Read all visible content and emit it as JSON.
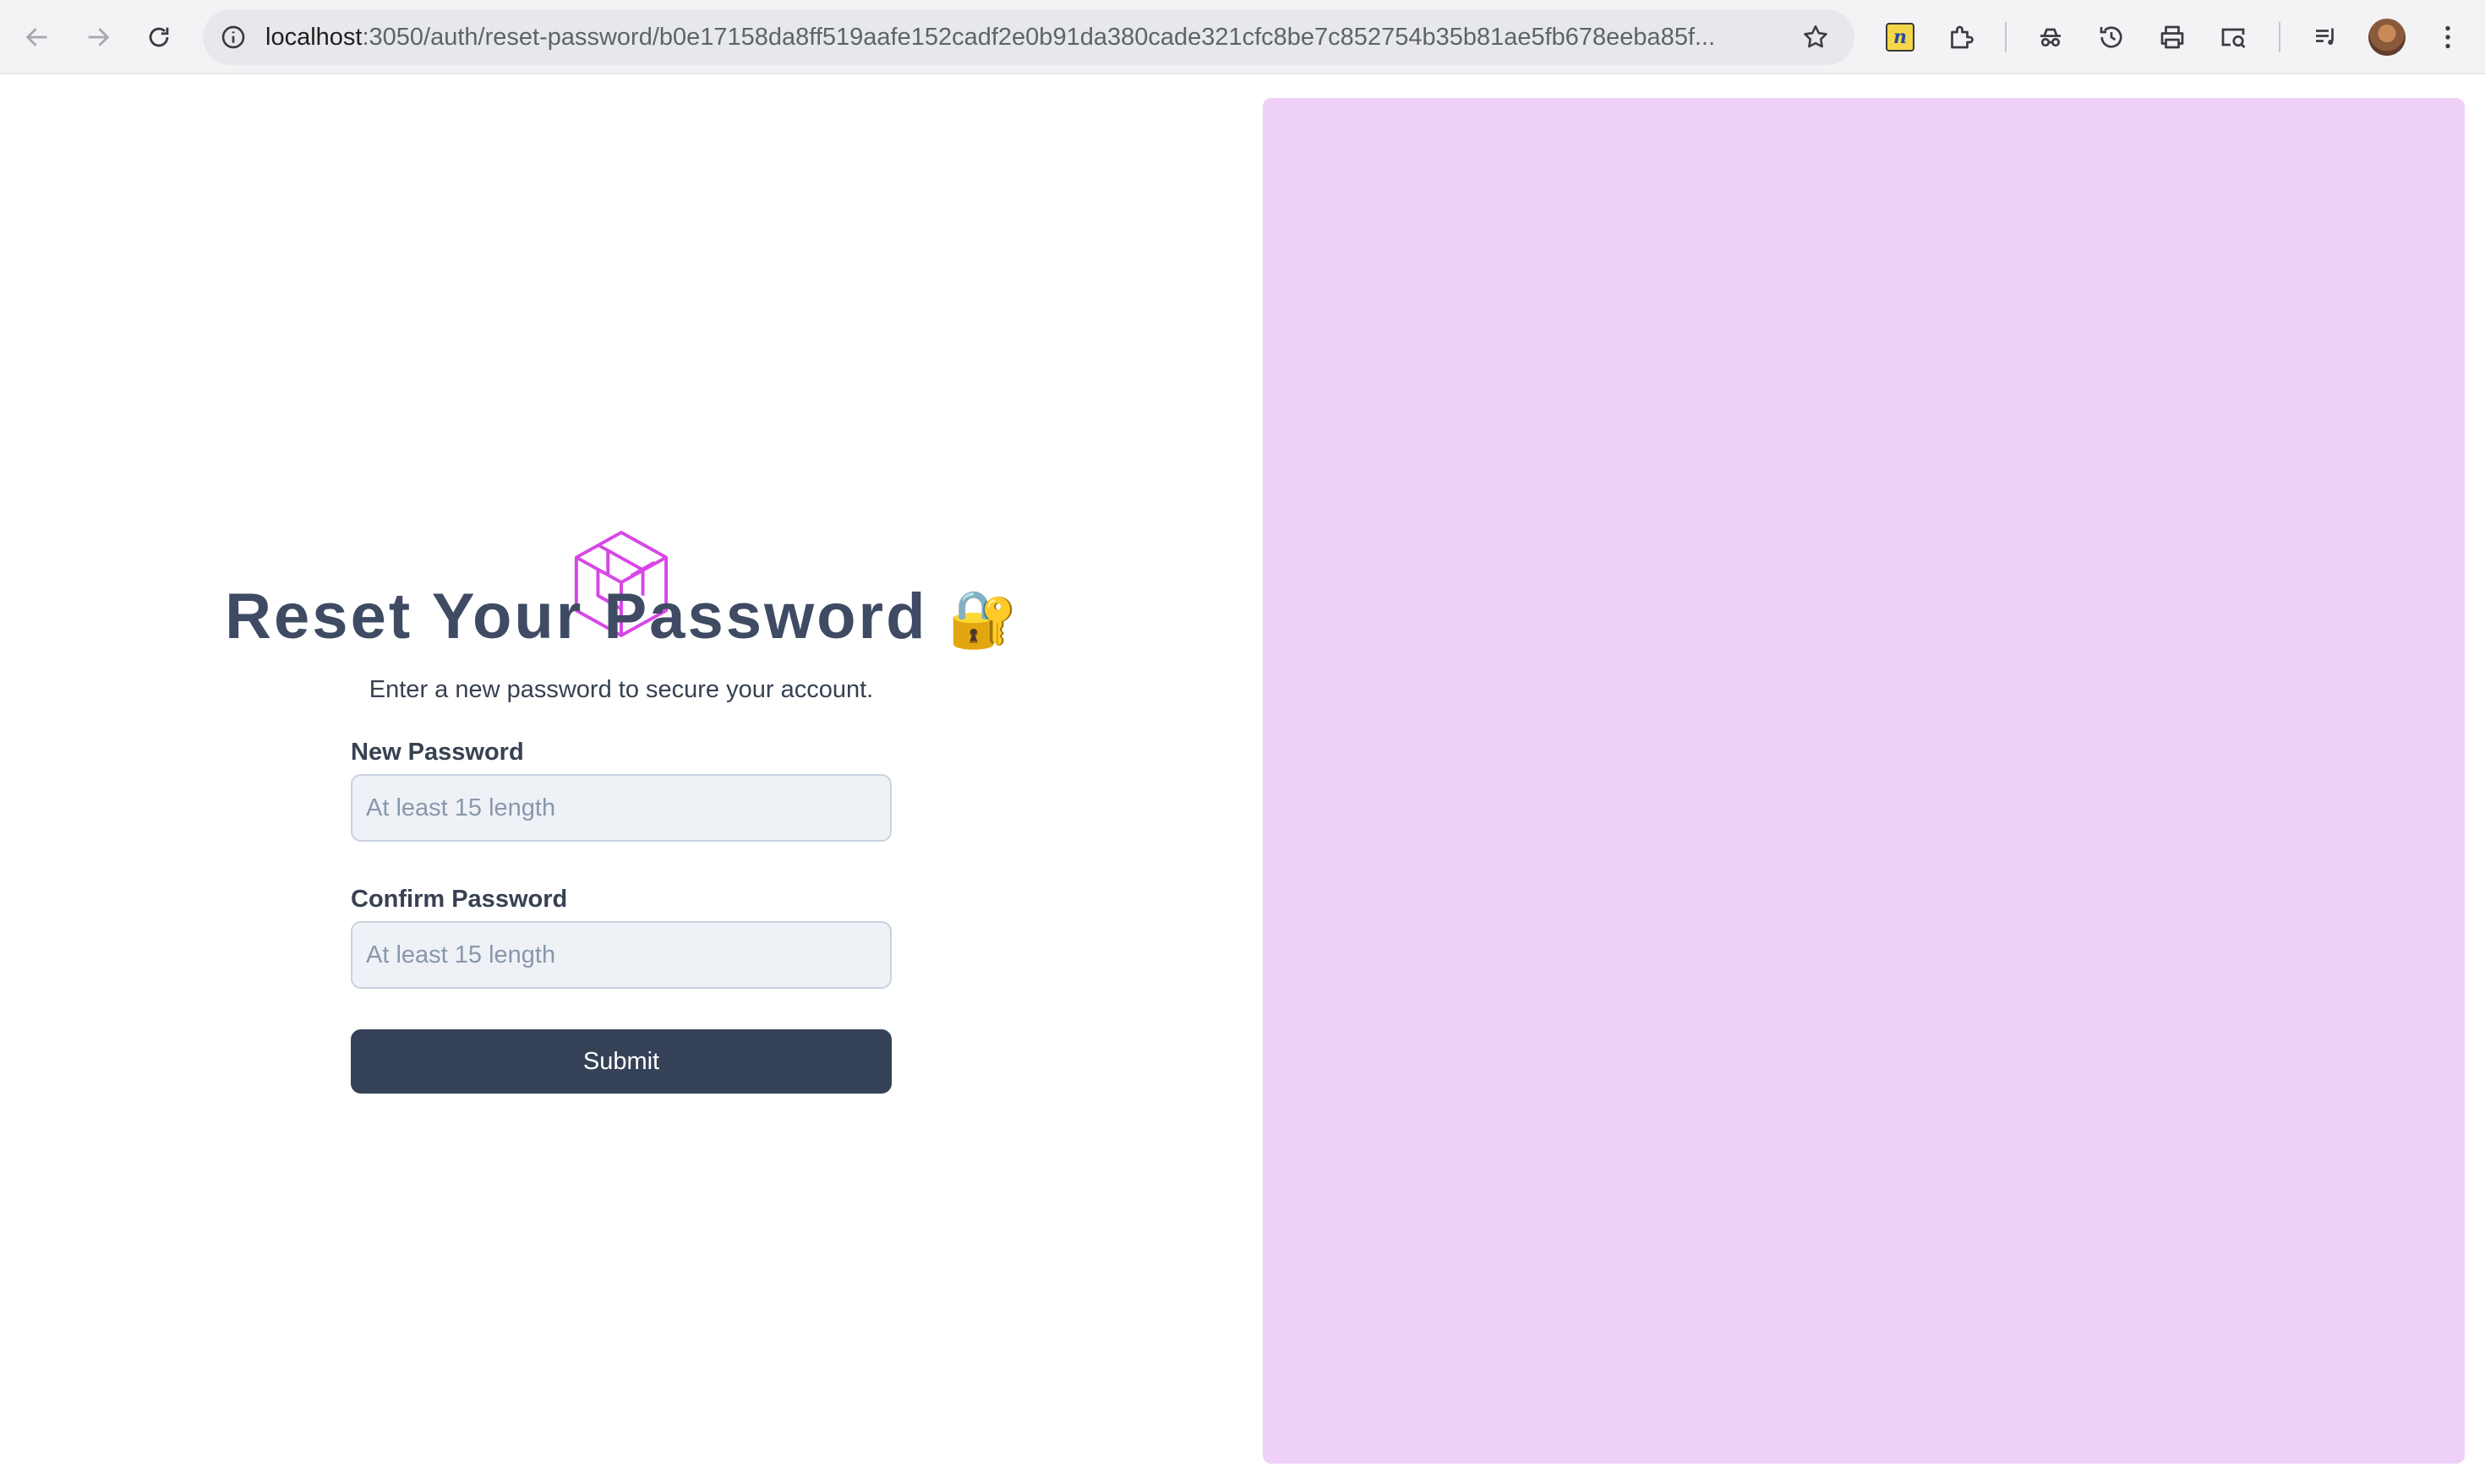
{
  "browser": {
    "url_host": "localhost",
    "url_rest": ":3050/auth/reset-password/b0e17158da8ff519aafe152cadf2e0b91da380cade321cfc8be7c852754b35b81ae5fb678eeba85f...",
    "extension_badge": "n"
  },
  "icons": {
    "back": "arrow-left-icon",
    "forward": "arrow-right-icon",
    "reload": "reload-icon",
    "info": "info-icon",
    "bookmark": "star-icon",
    "extensions": "puzzle-icon",
    "incognito": "incognito-icon",
    "history": "history-icon",
    "print": "printer-icon",
    "lens": "search-image-icon",
    "media": "media-controls-icon",
    "menu": "kebab-menu-icon"
  },
  "colors": {
    "accent_logo": "#d846e8",
    "title": "#3f4b63",
    "button": "#354157",
    "right_panel": "#efd1f8"
  },
  "form": {
    "title": "Reset Your Password",
    "title_emoji": "🔐",
    "subtitle": "Enter a new password to secure your account.",
    "new_password_label": "New Password",
    "new_password_placeholder": "At least 15 length",
    "new_password_value": "",
    "confirm_password_label": "Confirm Password",
    "confirm_password_placeholder": "At least 15 length",
    "confirm_password_value": "",
    "submit_label": "Submit"
  }
}
